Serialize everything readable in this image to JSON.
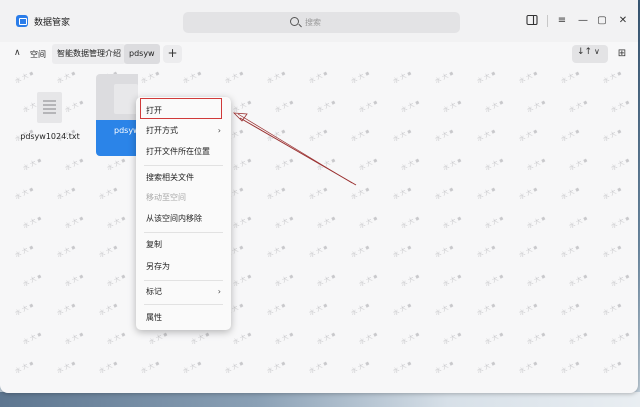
{
  "app": {
    "title": "数据管家",
    "icon": "app-logo-icon"
  },
  "search": {
    "placeholder": "搜索",
    "icon": "search-icon"
  },
  "window_controls": {
    "sidebar_toggle_icon": "sidebar-toggle-icon",
    "menu_icon": "≡",
    "minimize_icon": "—",
    "maximize_icon": "▢",
    "close_icon": "✕"
  },
  "toolbar": {
    "collapse_icon": "∧",
    "space_label": "空间",
    "tabs": [
      {
        "label": "智能数据管理介绍"
      },
      {
        "label": "pdsyw"
      }
    ],
    "add_label": "+",
    "sort_icon": "↓↑",
    "sort_chevron": "∨",
    "view_icon": "⊞"
  },
  "files": [
    {
      "name": "pdsyw1024.txt",
      "selected": false
    },
    {
      "name": "pdsyw",
      "selected": true
    }
  ],
  "watermark_text": "水 大 ▪",
  "context_menu": {
    "items": [
      {
        "label": "打开",
        "submenu": false,
        "disabled": false
      },
      {
        "label": "打开方式",
        "submenu": true,
        "disabled": false
      },
      {
        "label": "打开文件所在位置",
        "submenu": false,
        "disabled": false
      },
      {
        "label": "搜索相关文件",
        "submenu": false,
        "disabled": false
      },
      {
        "label": "移动至空间",
        "submenu": false,
        "disabled": true
      },
      {
        "label": "从该空间内移除",
        "submenu": false,
        "disabled": false
      },
      {
        "label": "复制",
        "submenu": false,
        "disabled": false
      },
      {
        "label": "另存为",
        "submenu": false,
        "disabled": false
      },
      {
        "label": "标记",
        "submenu": true,
        "disabled": false
      },
      {
        "label": "属性",
        "submenu": false,
        "disabled": false
      }
    ],
    "chevron": "›"
  },
  "colors": {
    "accent": "#2b84e8",
    "annotation": "#d03a3a"
  }
}
